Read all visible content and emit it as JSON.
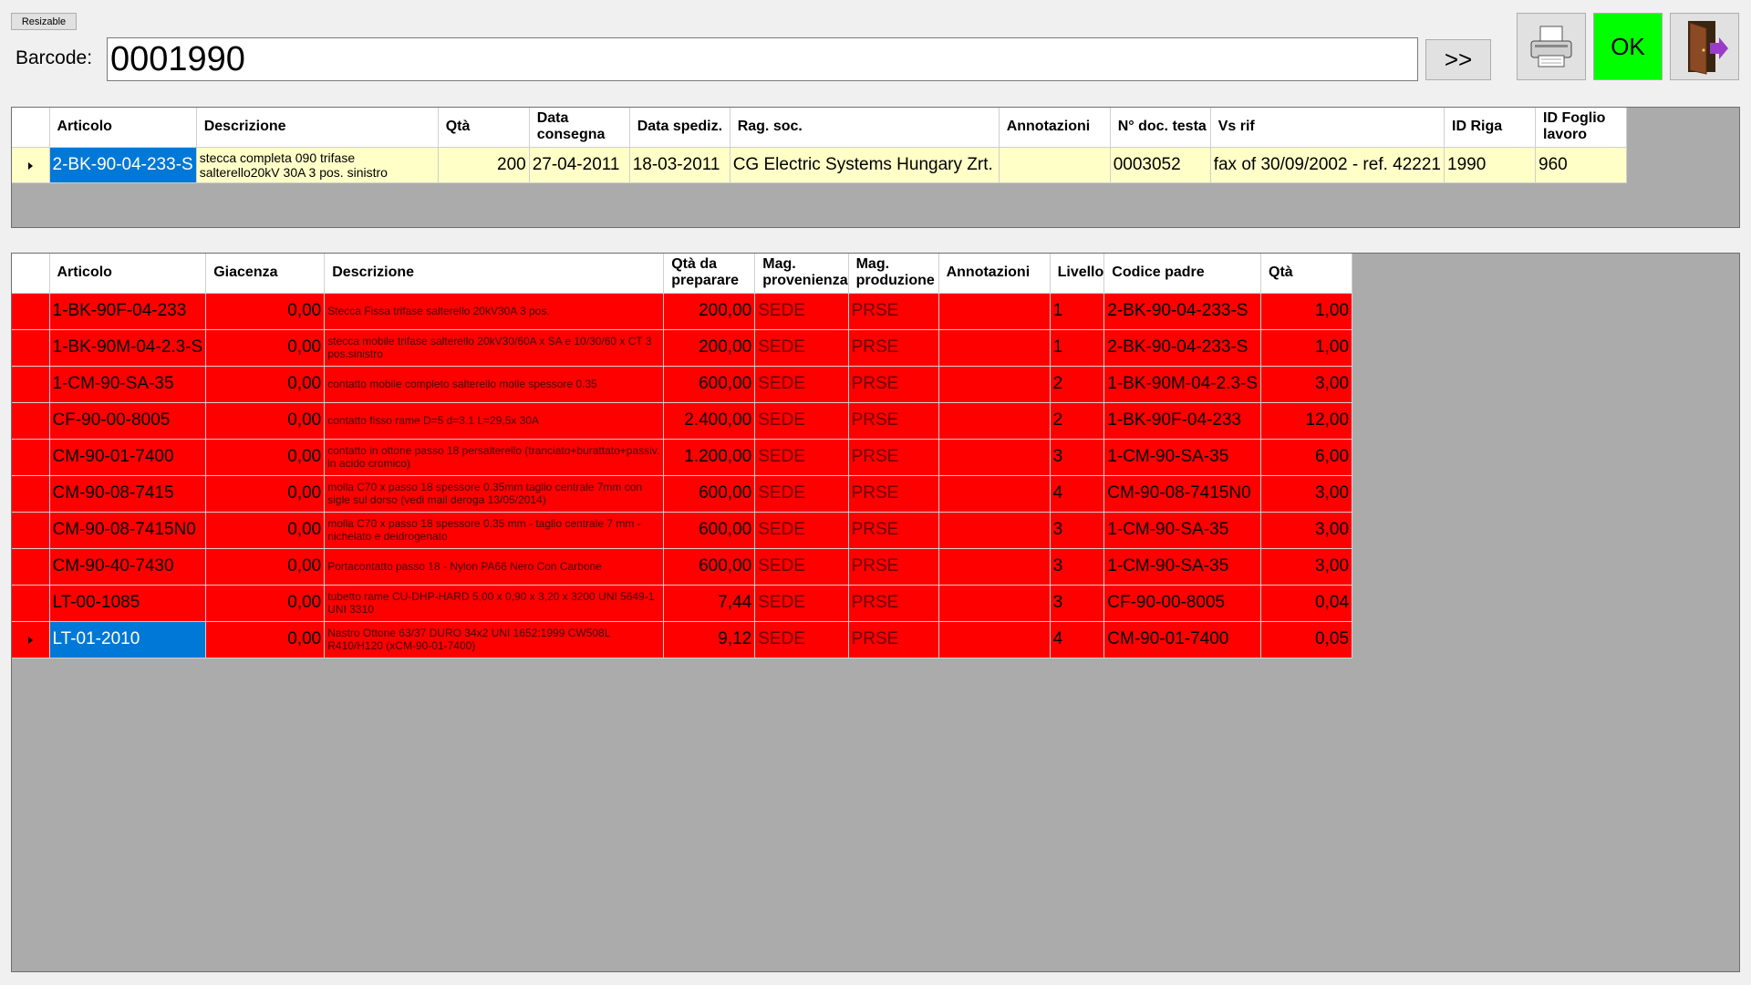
{
  "window": {
    "resizable_label": "Resizable"
  },
  "barcode": {
    "label": "Barcode:",
    "value": "0001990"
  },
  "buttons": {
    "go_label": ">>",
    "ok_label": "OK",
    "print_icon": "printer-icon",
    "exit_icon": "exit-door-icon",
    "ok_color": "#00ff00"
  },
  "colors": {
    "selection": "#0078d7",
    "header_row_bg": "#ffffc8",
    "component_row_bg": "#ff0000",
    "grid_bg": "#ababab"
  },
  "order_grid": {
    "columns": [
      "Articolo",
      "Descrizione",
      "Qtà",
      "Data consegna",
      "Data spediz.",
      "Rag. soc.",
      "Annotazioni",
      "N° doc. testa",
      "Vs rif",
      "ID Riga",
      "ID Foglio lavoro"
    ],
    "rows": [
      [
        "2-BK-90-04-233-S",
        "stecca completa 090  trifase salterello20kV 30A 3 pos. sinistro",
        "200",
        "27-04-2011",
        "18-03-2011",
        "CG Electric Systems Hungary Zrt.",
        "",
        "0003052",
        "fax of 30/09/2002 - ref. 42221",
        "1990",
        "960"
      ]
    ]
  },
  "component_grid": {
    "columns": [
      "Articolo",
      "Giacenza",
      "Descrizione",
      "Qtà da preparare",
      "Mag. provenienza",
      "Mag. produzione",
      "Annotazioni",
      "Livello",
      "Codice padre",
      "Qtà"
    ],
    "rows": [
      [
        "1-BK-90F-04-233",
        "0,00",
        "Stecca Fissa trifase salterello 20kV30A 3 pos.",
        "200,00",
        "SEDE",
        "PRSE",
        "",
        "1",
        "2-BK-90-04-233-S",
        "1,00"
      ],
      [
        "1-BK-90M-04-2.3-S",
        "0,00",
        "stecca mobile trifase salterello 20kV30/60A x SA e 10/30/60 x CT 3 pos.sinistro",
        "200,00",
        "SEDE",
        "PRSE",
        "",
        "1",
        "2-BK-90-04-233-S",
        "1,00"
      ],
      [
        "1-CM-90-SA-35",
        "0,00",
        "contatto mobile completo salterello molle spessore 0.35",
        "600,00",
        "SEDE",
        "PRSE",
        "",
        "2",
        "1-BK-90M-04-2.3-S",
        "3,00"
      ],
      [
        "CF-90-00-8005",
        "0,00",
        "contatto fisso rame  D=5 d=3.1 L=29,5x 30A",
        "2.400,00",
        "SEDE",
        "PRSE",
        "",
        "2",
        "1-BK-90F-04-233",
        "12,00"
      ],
      [
        "CM-90-01-7400",
        "0,00",
        "contatto in ottone passo 18 persalterello (tranciato+burattato+passiv. in acido cromico)",
        "1.200,00",
        "SEDE",
        "PRSE",
        "",
        "3",
        "1-CM-90-SA-35",
        "6,00"
      ],
      [
        "CM-90-08-7415",
        "0,00",
        "molla C70 x passo 18 spessore 0.35mm taglio centrale 7mm con sigle sul dorso (vedi mail deroga 13/05/2014)",
        "600,00",
        "SEDE",
        "PRSE",
        "",
        "4",
        "CM-90-08-7415N0",
        "3,00"
      ],
      [
        "CM-90-08-7415N0",
        "0,00",
        "molla C70 x passo 18 spessore 0.35 mm - taglio centrale 7 mm - nichelato e deidrogenato",
        "600,00",
        "SEDE",
        "PRSE",
        "",
        "3",
        "1-CM-90-SA-35",
        "3,00"
      ],
      [
        "CM-90-40-7430",
        "0,00",
        "Portacontatto passo 18 - Nylon PA66 Nero Con Carbone",
        "600,00",
        "SEDE",
        "PRSE",
        "",
        "3",
        "1-CM-90-SA-35",
        "3,00"
      ],
      [
        "LT-00-1085",
        "0,00",
        "tubetto rame CU-DHP-HARD 5,00 x 0,90 x 3,20 x 3200 UNI 5649-1 UNI 3310",
        "7,44",
        "SEDE",
        "PRSE",
        "",
        "3",
        "CF-90-00-8005",
        "0,04"
      ],
      [
        "LT-01-2010",
        "0,00",
        "Nastro Ottone 63/37 DURO 34x2 UNI 1652:1999 CW508L R410/H120 (xCM-90-01-7400)",
        "9,12",
        "SEDE",
        "PRSE",
        "",
        "4",
        "CM-90-01-7400",
        "0,05"
      ]
    ],
    "current_row_index": 9
  }
}
